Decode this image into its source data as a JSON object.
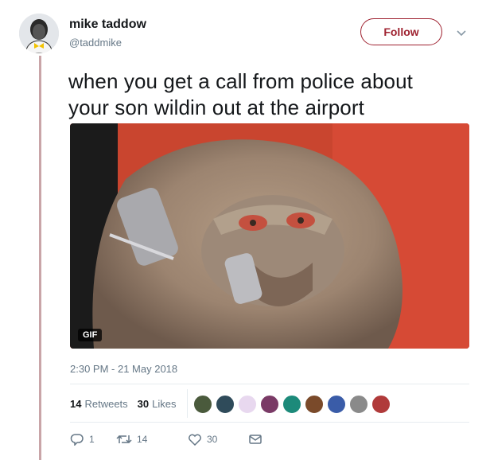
{
  "author": {
    "name": "mike taddow",
    "handle": "@taddmike"
  },
  "follow_label": "Follow",
  "tweet": {
    "line1": "when you get a call from police about",
    "line2": "your son wildin out at the airport"
  },
  "media": {
    "badge": "GIF"
  },
  "timestamp": "2:30 PM - 21 May 2018",
  "stats": {
    "retweets_count": "14",
    "retweets_label": "Retweets",
    "likes_count": "30",
    "likes_label": "Likes"
  },
  "actions": {
    "replies": "1",
    "retweets": "14",
    "likes": "30"
  },
  "colors": {
    "accent": "#9f2230",
    "secondary_text": "#657786",
    "thread_line": "#c9a5a8"
  },
  "icons": [
    "caret-down-icon",
    "reply-icon",
    "retweet-icon",
    "heart-icon",
    "message-icon"
  ]
}
